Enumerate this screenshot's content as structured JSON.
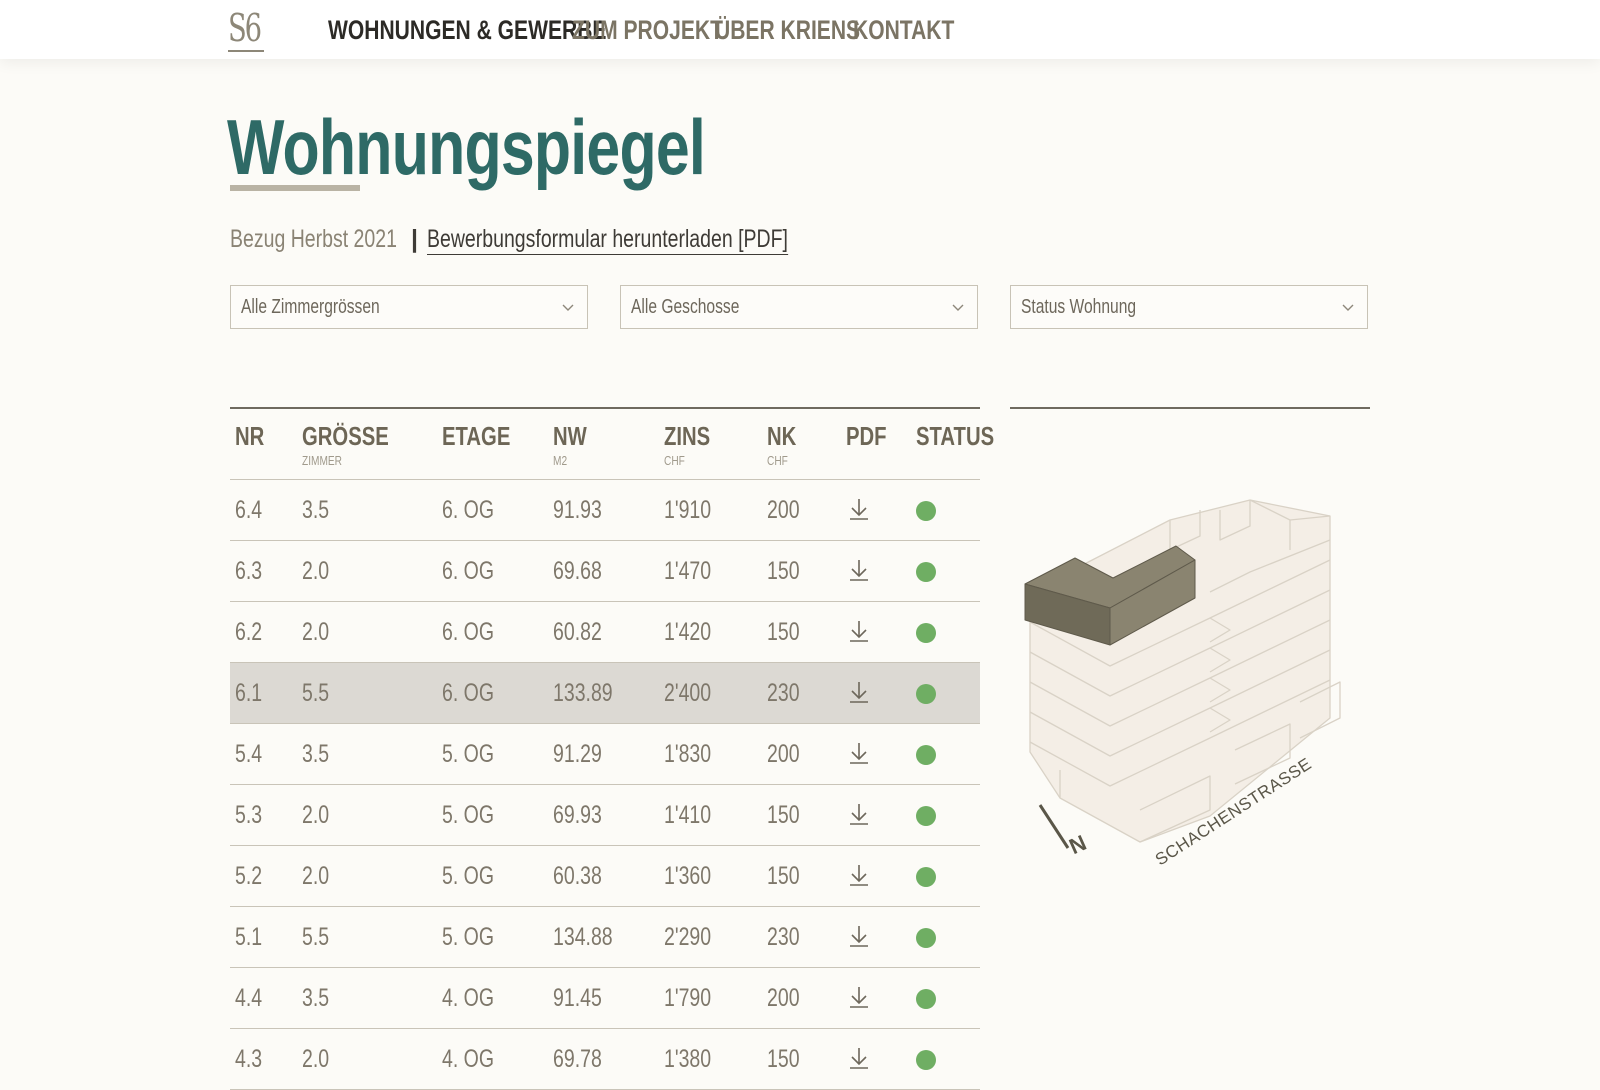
{
  "header": {
    "logo": "S6",
    "nav": [
      {
        "label": "WOHNUNGEN & GEWERBE",
        "active": true
      },
      {
        "label": "ZUM PROJEKT",
        "active": false
      },
      {
        "label": "ÜBER KRIENS",
        "active": false
      },
      {
        "label": "KONTAKT",
        "active": false
      }
    ]
  },
  "page": {
    "title": "Wohnungspiegel",
    "bezug": "Bezug Herbst 2021",
    "separator": "|",
    "pdf_link": "Bewerbungsformular herunterladen [PDF]"
  },
  "filters": [
    {
      "selected": "Alle Zimmergrössen"
    },
    {
      "selected": "Alle Geschosse"
    },
    {
      "selected": "Status Wohnung"
    }
  ],
  "table": {
    "columns": [
      {
        "label": "NR",
        "sub": ""
      },
      {
        "label": "GRÖSSE",
        "sub": "ZIMMER"
      },
      {
        "label": "ETAGE",
        "sub": ""
      },
      {
        "label": "NW",
        "sub": "M2"
      },
      {
        "label": "ZINS",
        "sub": "CHF"
      },
      {
        "label": "NK",
        "sub": "CHF"
      },
      {
        "label": "PDF",
        "sub": ""
      },
      {
        "label": "STATUS",
        "sub": ""
      }
    ],
    "rows": [
      {
        "nr": "6.4",
        "groesse": "3.5",
        "etage": "6. OG",
        "nw": "91.93",
        "zins": "1'910",
        "nk": "200",
        "status": "frei",
        "highlight": false
      },
      {
        "nr": "6.3",
        "groesse": "2.0",
        "etage": "6. OG",
        "nw": "69.68",
        "zins": "1'470",
        "nk": "150",
        "status": "frei",
        "highlight": false
      },
      {
        "nr": "6.2",
        "groesse": "2.0",
        "etage": "6. OG",
        "nw": "60.82",
        "zins": "1'420",
        "nk": "150",
        "status": "frei",
        "highlight": false
      },
      {
        "nr": "6.1",
        "groesse": "5.5",
        "etage": "6. OG",
        "nw": "133.89",
        "zins": "2'400",
        "nk": "230",
        "status": "frei",
        "highlight": true
      },
      {
        "nr": "5.4",
        "groesse": "3.5",
        "etage": "5. OG",
        "nw": "91.29",
        "zins": "1'830",
        "nk": "200",
        "status": "frei",
        "highlight": false
      },
      {
        "nr": "5.3",
        "groesse": "2.0",
        "etage": "5. OG",
        "nw": "69.93",
        "zins": "1'410",
        "nk": "150",
        "status": "frei",
        "highlight": false
      },
      {
        "nr": "5.2",
        "groesse": "2.0",
        "etage": "5. OG",
        "nw": "60.38",
        "zins": "1'360",
        "nk": "150",
        "status": "frei",
        "highlight": false
      },
      {
        "nr": "5.1",
        "groesse": "5.5",
        "etage": "5. OG",
        "nw": "134.88",
        "zins": "2'290",
        "nk": "230",
        "status": "frei",
        "highlight": false
      },
      {
        "nr": "4.4",
        "groesse": "3.5",
        "etage": "4. OG",
        "nw": "91.45",
        "zins": "1'790",
        "nk": "200",
        "status": "frei",
        "highlight": false
      },
      {
        "nr": "4.3",
        "groesse": "2.0",
        "etage": "4. OG",
        "nw": "69.78",
        "zins": "1'380",
        "nk": "150",
        "status": "frei",
        "highlight": false
      }
    ]
  },
  "plan": {
    "north_label": "N",
    "street_label": "SCHACHENSTRASSE"
  },
  "colors": {
    "accent": "#2e6a66",
    "status_free": "#6fae63",
    "highlight_row": "#dcd9d3",
    "selected_unit": "#7a7564"
  },
  "icons": {
    "pdf": "download-icon",
    "filter": "chevron-down-icon"
  }
}
